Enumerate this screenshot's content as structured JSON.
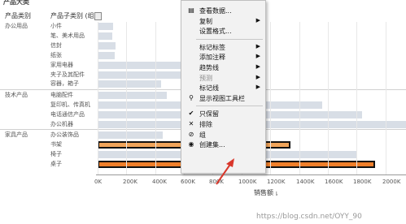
{
  "view": {
    "title_fragment": "产品大类",
    "col_header_category": "产品类别",
    "col_header_subcategory": "产品子类别 (组)",
    "categories": [
      {
        "name": "办公用品",
        "items": [
          {
            "label": "小件",
            "value": 110000
          },
          {
            "label": "笔、美术用品",
            "value": 100000
          },
          {
            "label": "信封",
            "value": 125000
          },
          {
            "label": "纸张",
            "value": 120000
          },
          {
            "label": "家用电器",
            "value": 680000
          },
          {
            "label": "夹子及其配件",
            "value": 970000
          },
          {
            "label": "容器，箱子",
            "value": 440000
          }
        ]
      },
      {
        "name": "技术产品",
        "items": [
          {
            "label": "电脑配件",
            "value": 480000
          },
          {
            "label": "复印机、传真机",
            "value": 1560000
          },
          {
            "label": "电话通信产品",
            "value": 1840000
          },
          {
            "label": "办公机器",
            "value": 2160000
          }
        ]
      },
      {
        "name": "家具产品",
        "items": [
          {
            "label": "办公装饰品",
            "value": 450000
          },
          {
            "label": "书架",
            "value": 1340000,
            "highlight": "light"
          },
          {
            "label": "椅子",
            "value": 1800000
          },
          {
            "label": "桌子",
            "value": 1930000,
            "highlight": "dark"
          }
        ]
      }
    ],
    "x_axis": {
      "ticks": [
        "0K",
        "200K",
        "400K",
        "600K",
        "800K",
        "1000K",
        "1200K",
        "1400K",
        "1600K",
        "1800K",
        "2000K",
        "220"
      ],
      "label": "销售额",
      "max": 2200000
    }
  },
  "context_menu": {
    "items": [
      {
        "label": "查看数据...",
        "icon": "table-icon",
        "submenu": false
      },
      {
        "label": "复制",
        "submenu": true
      },
      {
        "label": "设置格式...",
        "submenu": false
      },
      {
        "separator": true
      },
      {
        "label": "标记标签",
        "submenu": true
      },
      {
        "label": "添加注释",
        "submenu": true
      },
      {
        "label": "趋势线",
        "submenu": true
      },
      {
        "label": "预测",
        "submenu": true,
        "disabled": true
      },
      {
        "label": "标记线",
        "submenu": true
      },
      {
        "label": "显示视图工具栏",
        "icon": "zoom-icon",
        "submenu": false
      },
      {
        "separator": true
      },
      {
        "label": "只保留",
        "icon": "check-icon",
        "submenu": false
      },
      {
        "label": "排除",
        "icon": "x-icon",
        "submenu": false
      },
      {
        "label": "组",
        "icon": "paperclip-icon",
        "submenu": false
      },
      {
        "label": "创建集...",
        "icon": "set-icon",
        "submenu": false
      }
    ]
  },
  "watermark": "https://blog.csdn.net/OYY_90",
  "colors": {
    "bar_default": "#d8dee6",
    "bar_highlight_light": "#f0a45a",
    "bar_highlight_dark": "#ef7f2b",
    "arrow": "#d9372b"
  }
}
